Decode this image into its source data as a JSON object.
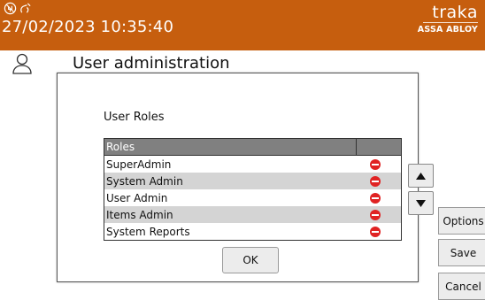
{
  "header": {
    "datetime": "27/02/2023 10:35:40",
    "brand_logo": "traka",
    "brand_sub": "ASSA ABLOY",
    "status_icons": [
      "usb-disconnected-icon",
      "network-off-icon"
    ],
    "bg_color": "#c65e0e"
  },
  "page": {
    "title": "User administration",
    "icon": "user-icon"
  },
  "dialog": {
    "label": "User Roles",
    "table": {
      "columns": [
        "Roles",
        ""
      ],
      "rows": [
        {
          "role": "SuperAdmin",
          "action_icon": "remove-icon"
        },
        {
          "role": "System Admin",
          "action_icon": "remove-icon"
        },
        {
          "role": "User Admin",
          "action_icon": "remove-icon"
        },
        {
          "role": "Items Admin",
          "action_icon": "remove-icon"
        },
        {
          "role": "System Reports",
          "action_icon": "remove-icon"
        }
      ],
      "remove_color": "#e02323"
    },
    "ok_label": "OK",
    "move_up_icon": "arrow-up-icon",
    "move_down_icon": "arrow-down-icon"
  },
  "side_buttons": {
    "options": "Options",
    "save": "Save",
    "cancel": "Cancel"
  }
}
